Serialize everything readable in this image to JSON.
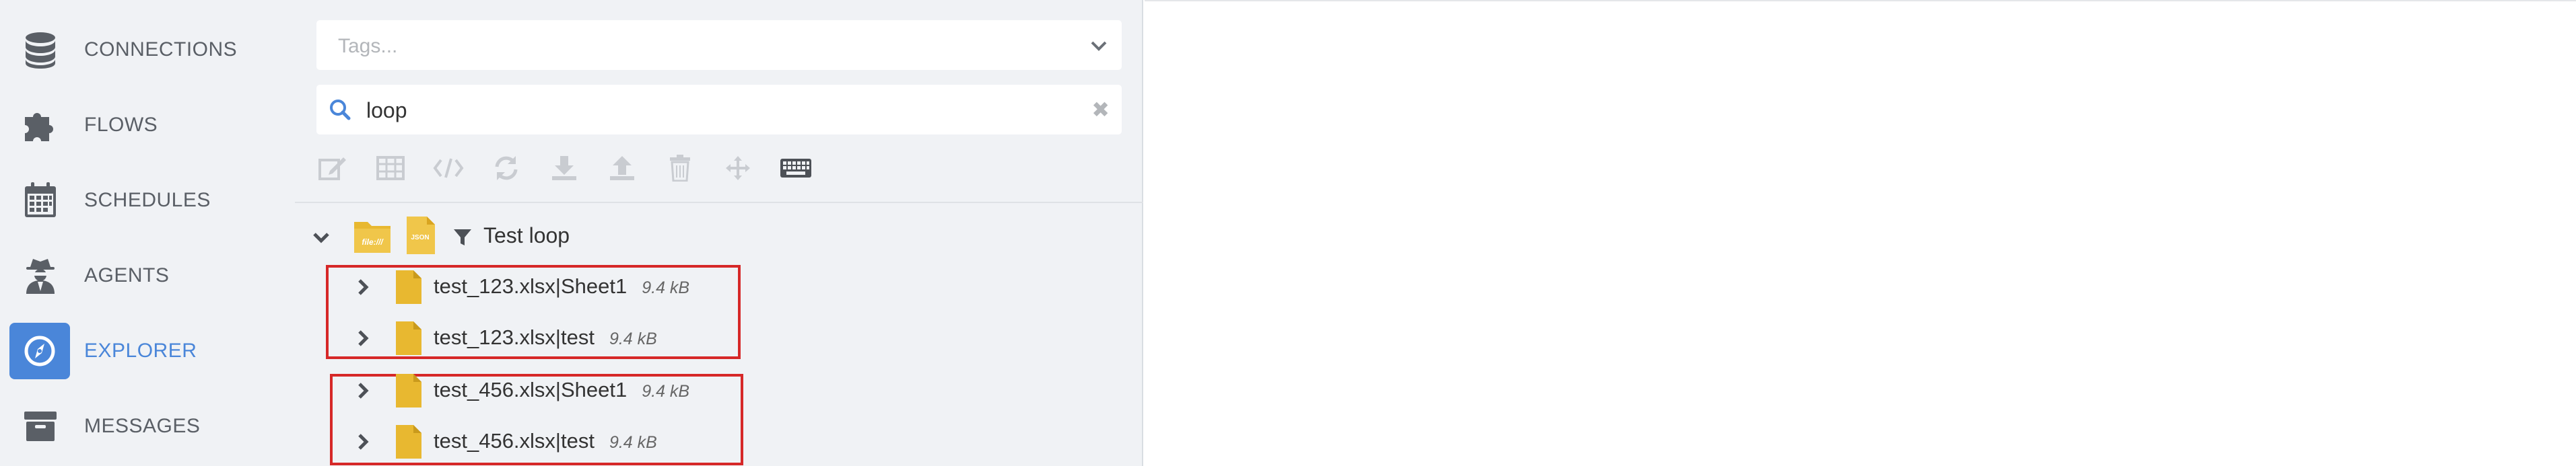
{
  "sidebar": {
    "items": [
      {
        "label": "CONNECTIONS",
        "icon": "database-icon"
      },
      {
        "label": "FLOWS",
        "icon": "puzzle-icon"
      },
      {
        "label": "SCHEDULES",
        "icon": "calendar-icon"
      },
      {
        "label": "AGENTS",
        "icon": "agent-icon"
      },
      {
        "label": "EXPLORER",
        "icon": "compass-icon",
        "active": true
      },
      {
        "label": "MESSAGES",
        "icon": "archive-icon"
      }
    ]
  },
  "explorer": {
    "tags": {
      "placeholder": "Tags..."
    },
    "search": {
      "value": "loop"
    },
    "toolbar": [
      "edit-icon",
      "table-icon",
      "code-icon",
      "refresh-icon",
      "download-icon",
      "upload-icon",
      "trash-icon",
      "move-icon",
      "keyboard-icon"
    ],
    "tree": {
      "root": {
        "label": "Test loop",
        "folder_badge": "file:///",
        "doc_badge": "JSON"
      },
      "rows": [
        {
          "name": "test_123.xlsx|Sheet1",
          "size": "9.4 kB"
        },
        {
          "name": "test_123.xlsx|test",
          "size": "9.4 kB"
        },
        {
          "name": "test_456.xlsx|Sheet1",
          "size": "9.4 kB"
        },
        {
          "name": "test_456.xlsx|test",
          "size": "9.4 kB"
        }
      ]
    }
  },
  "colors": {
    "accent": "#4a86d9",
    "sidebar_bg": "#f0f2f5",
    "file_icon": "#e8b830",
    "highlight_box": "#d62828"
  }
}
